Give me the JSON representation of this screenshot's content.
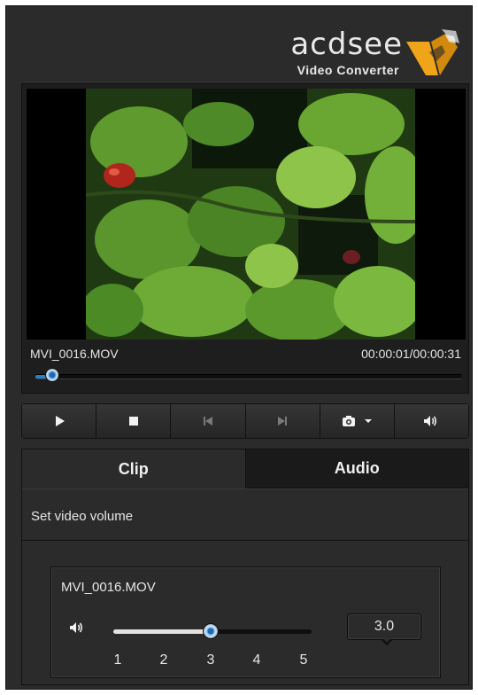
{
  "logo": {
    "brand": "acdsee",
    "product": "Video Converter"
  },
  "player": {
    "file_name": "MVI_0016.MOV",
    "time_code": "00:00:01/00:00:31",
    "progress_fraction": 0.03
  },
  "transport": {
    "buttons": [
      {
        "name": "play-button",
        "icon": "play-icon"
      },
      {
        "name": "stop-button",
        "icon": "stop-icon"
      },
      {
        "name": "previous-button",
        "icon": "skip-back-icon"
      },
      {
        "name": "next-button",
        "icon": "skip-forward-icon"
      },
      {
        "name": "snapshot-button",
        "icon": "camera-icon"
      },
      {
        "name": "volume-button",
        "icon": "speaker-icon"
      }
    ]
  },
  "tabs": [
    {
      "label": "Clip",
      "active": false
    },
    {
      "label": "Audio",
      "active": true
    }
  ],
  "audio": {
    "section_label": "Set video volume",
    "file_name": "MVI_0016.MOV",
    "volume_value": "3.0",
    "volume_level": 3.0,
    "volume_range": [
      1,
      5
    ],
    "ticks": [
      "1",
      "2",
      "3",
      "4",
      "5"
    ]
  },
  "colors": {
    "accent": "#2f7fc4",
    "panel": "#2b2b2b",
    "logo_orange": "#f0a419"
  }
}
